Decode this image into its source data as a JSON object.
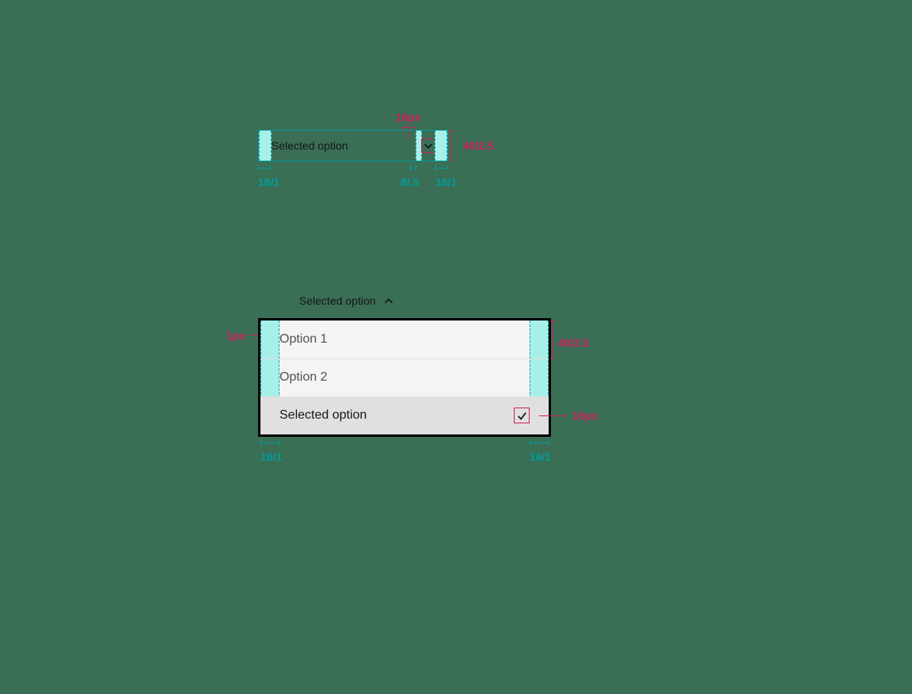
{
  "top": {
    "label": "Selected option",
    "icon_size_label": "16px",
    "height_label": "40/2.5",
    "dims": {
      "left": "16/1",
      "mid": "8/.5",
      "right": "16/1"
    }
  },
  "bottom": {
    "trigger_label": "Selected option",
    "options": [
      "Option 1",
      "Option 2",
      "Selected option"
    ],
    "row_height_label": "40/2.5",
    "divider_label": "1px",
    "check_size_label": "16px",
    "dims": {
      "left": "16/1",
      "right": "16/1"
    }
  }
}
